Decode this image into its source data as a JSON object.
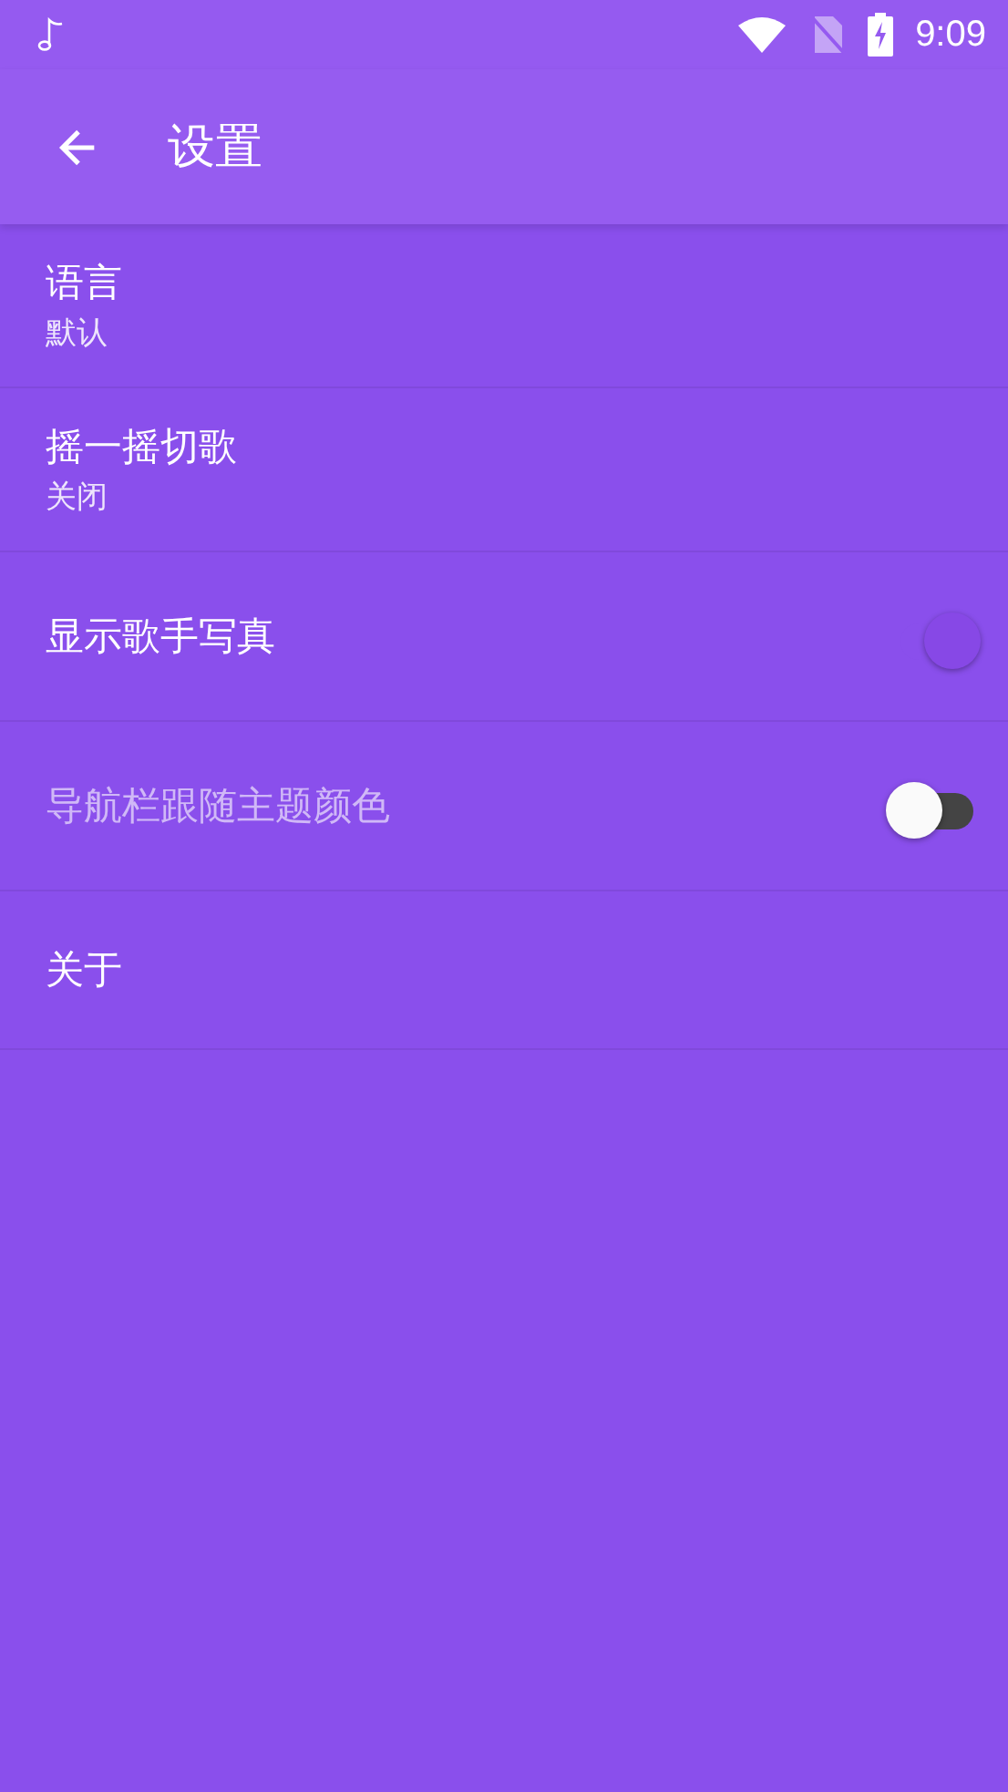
{
  "status_bar": {
    "time": "9:09"
  },
  "toolbar": {
    "title": "设置"
  },
  "settings": [
    {
      "kind": "text",
      "title": "语言",
      "summary": "默认"
    },
    {
      "kind": "text",
      "title": "摇一摇切歌",
      "summary": "关闭"
    },
    {
      "kind": "switch",
      "title": "显示歌手写真",
      "on": true,
      "disabled": false
    },
    {
      "kind": "switch",
      "title": "导航栏跟随主题颜色",
      "on": false,
      "disabled": true
    },
    {
      "kind": "plain",
      "title": "关于"
    }
  ]
}
